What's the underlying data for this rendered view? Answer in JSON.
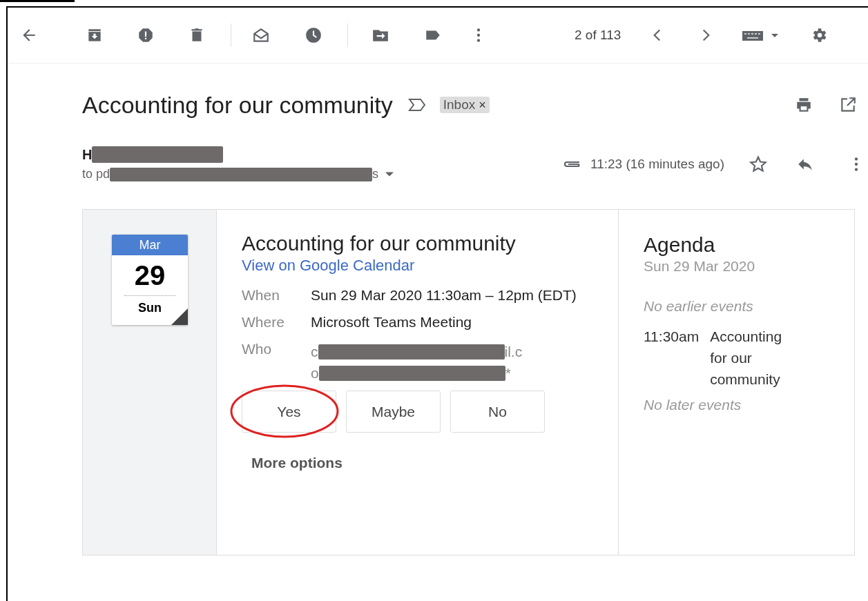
{
  "toolbar": {
    "pager": "2 of 113"
  },
  "message": {
    "subject": "Accounting for our community",
    "label": {
      "text": "Inbox",
      "close": "×"
    },
    "sender_visible": "H",
    "recipients_start": "to pd",
    "recipients_end": "s",
    "time": "11:23 (16 minutes ago)",
    "starred": false
  },
  "invite": {
    "date": {
      "month": "Mar",
      "day": "29",
      "weekday": "Sun"
    },
    "title": "Accounting for our community",
    "calendar_link": "View on Google Calendar",
    "details": [
      {
        "label": "When",
        "kind": "text",
        "value": "Sun 29 Mar 2020 11:30am – 12pm (EDT)"
      },
      {
        "label": "Where",
        "kind": "text",
        "value": "Microsoft Teams Meeting"
      },
      {
        "label": "Who",
        "kind": "redacted",
        "lines": [
          {
            "start": "c",
            "end": "il.c"
          },
          {
            "start": "o",
            "end": "*"
          }
        ]
      }
    ],
    "rsvp": [
      {
        "label": "Yes",
        "selected": false,
        "circled": true
      },
      {
        "label": "Maybe",
        "selected": false,
        "circled": false
      },
      {
        "label": "No",
        "selected": false,
        "circled": false
      }
    ],
    "more_options": "More options"
  },
  "agenda": {
    "title": "Agenda",
    "date": "Sun 29 Mar 2020",
    "before": "No earlier events",
    "events": [
      {
        "time": "11:30am",
        "title": "Accounting for our community"
      }
    ],
    "after": "No later events"
  }
}
